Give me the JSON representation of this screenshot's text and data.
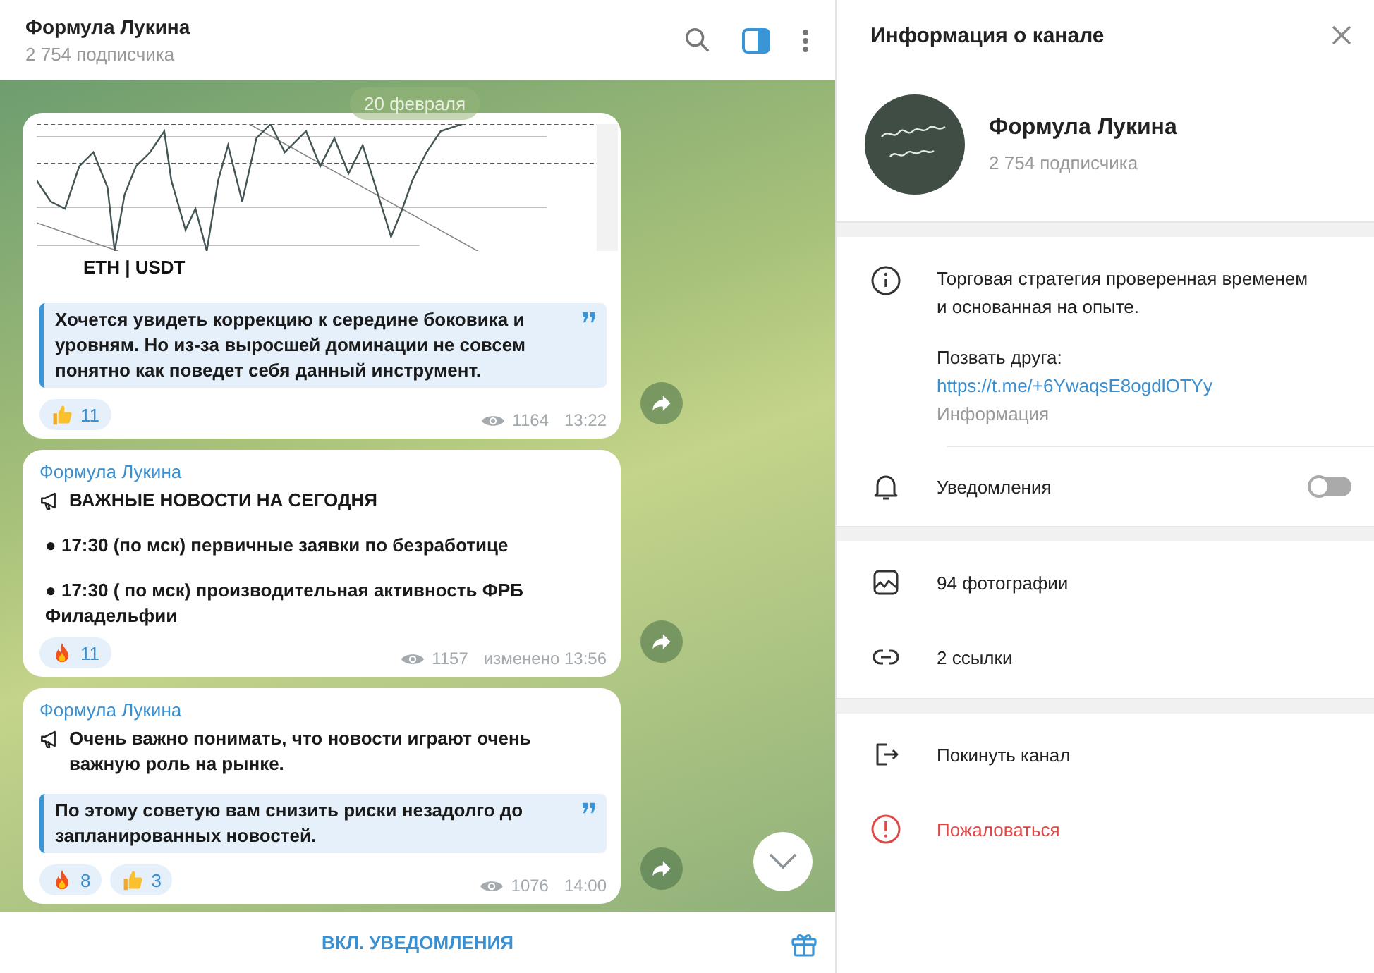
{
  "chat": {
    "header": {
      "title": "Формула Лукина",
      "subtitle": "2 754 подписчика"
    },
    "date_badge": "20 февраля",
    "messages": [
      {
        "image": {
          "caption": "ETH | USDT"
        },
        "quote": "Хочется увидеть коррекцию к середине боковика и уровням. Но из-за выросшей доминации не совсем понятно как поведет себя данный инструмент.",
        "reactions": [
          {
            "kind": "thumbs_up",
            "count": "11"
          }
        ],
        "views": "1164",
        "time": "13:22"
      },
      {
        "author": "Формула Лукина",
        "body": [
          {
            "kind": "announce",
            "text": "ВАЖНЫЕ НОВОСТИ НА СЕГОДНЯ"
          },
          {
            "kind": "bullet",
            "text": "● 17:30 (по мск) первичные заявки по безработице"
          },
          {
            "kind": "bullet",
            "text": "● 17:30 ( по мск) производительная активность ФРБ Филадельфии"
          }
        ],
        "reactions": [
          {
            "kind": "fire",
            "count": "11"
          }
        ],
        "views": "1157",
        "time": "изменено 13:56"
      },
      {
        "author": "Формула Лукина",
        "body": [
          {
            "kind": "announce",
            "text": "Очень важно понимать, что новости играют очень важную роль на рынке."
          }
        ],
        "quote": "По этому советую вам снизить риски незадолго до запланированных новостей.",
        "reactions": [
          {
            "kind": "fire",
            "count": "8"
          },
          {
            "kind": "thumbs_up",
            "count": "3"
          }
        ],
        "views": "1076",
        "time": "14:00"
      }
    ],
    "footer": {
      "action": "ВКЛ. УВЕДОМЛЕНИЯ"
    }
  },
  "info_panel": {
    "title": "Информация о канале",
    "channel": {
      "name": "Формула Лукина",
      "subtitle": "2 754 подписчика"
    },
    "description": "Торговая стратегия проверенная временем и основанная на опыте.",
    "invite_label": "Позвать друга:",
    "invite_link": "https://t.me/+6YwaqsE8ogdlOTYy",
    "info_label": "Информация",
    "notifications": {
      "label": "Уведомления",
      "on": false
    },
    "media": [
      {
        "kind": "photos",
        "label": "94 фотографии"
      },
      {
        "kind": "links",
        "label": "2 ссылки"
      }
    ],
    "actions": [
      {
        "kind": "leave",
        "label": "Покинуть канал"
      },
      {
        "kind": "report",
        "label": "Пожаловаться"
      }
    ]
  }
}
